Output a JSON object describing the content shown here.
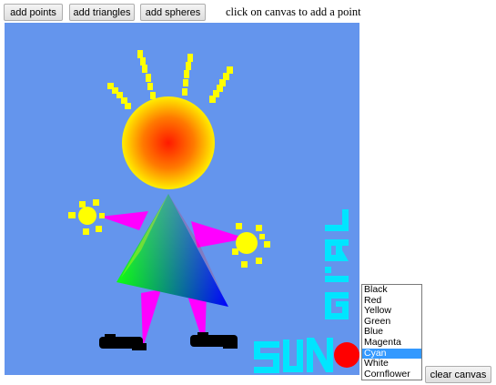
{
  "toolbar": {
    "add_points_label": "add points",
    "add_triangles_label": "add triangles",
    "add_spheres_label": "add spheres",
    "hint": "click on canvas to add a point"
  },
  "canvas": {
    "background_color": "#6495ED",
    "text_drawn": "SUN GiRL"
  },
  "color_list": {
    "options": [
      "Black",
      "Red",
      "Yellow",
      "Green",
      "Blue",
      "Magenta",
      "Cyan",
      "White",
      "Cornflower"
    ],
    "selected": "Cyan"
  },
  "clear_label": "clear canvas"
}
